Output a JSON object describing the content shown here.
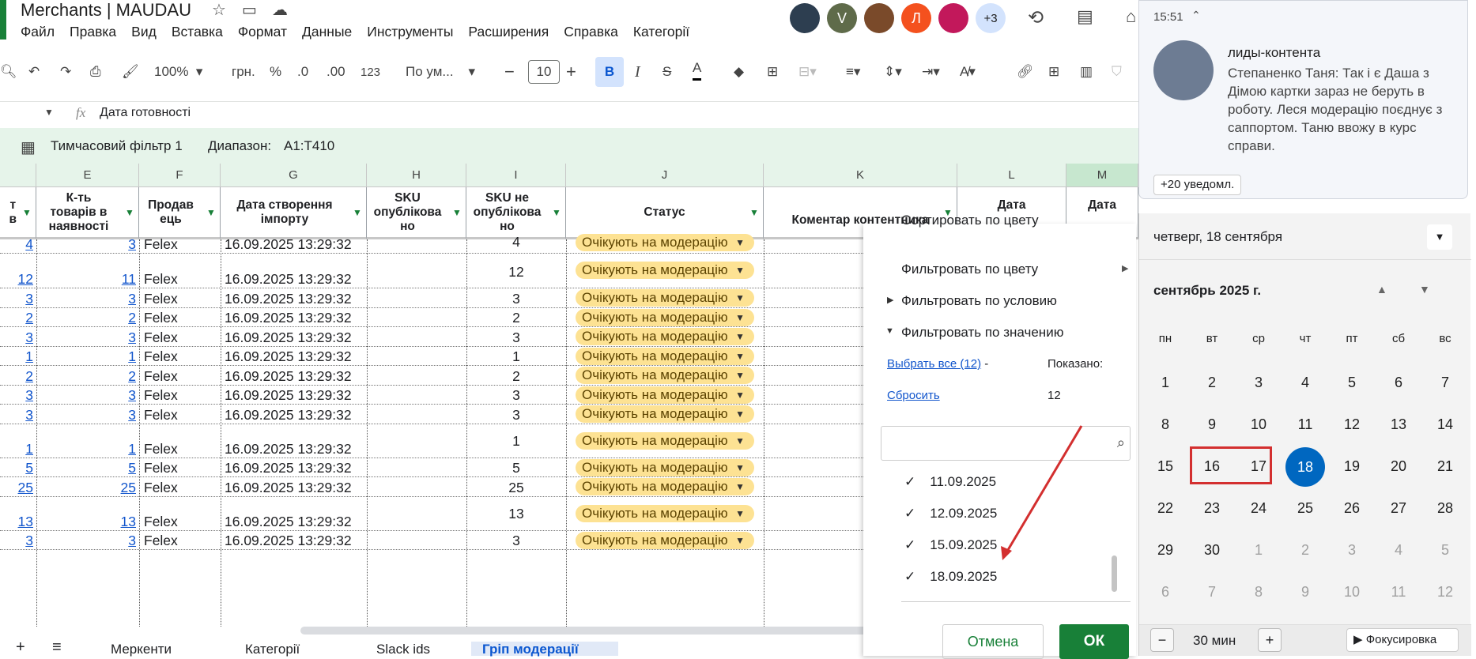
{
  "title": "Merchants | MAUDAU",
  "menu": [
    "Файл",
    "Правка",
    "Вид",
    "Вставка",
    "Формат",
    "Данные",
    "Инструменты",
    "Расширения",
    "Справка",
    "Категорії"
  ],
  "avatars": [
    {
      "letter": "V",
      "color": "#5f6b4a"
    },
    {
      "letter": "Л",
      "color": "#f4511e"
    },
    {
      "letter": "+3",
      "color": "#d3e3fd"
    }
  ],
  "toolbar": {
    "zoom": "100%",
    "currency": "грн.",
    "percent": "%",
    "dec_dec": ".0",
    "inc_dec": ".00",
    "fmt123": "123",
    "font": "По ум...",
    "font_size": "10",
    "bold": "B",
    "italic": "I"
  },
  "formula": {
    "content": "Дата готовності",
    "fx": "fx"
  },
  "filterbar": {
    "name": "Тимчасовий фільтр 1",
    "range_label": "Диапазон:",
    "range": "A1:T410"
  },
  "columns": [
    "E",
    "F",
    "G",
    "H",
    "I",
    "J",
    "K",
    "L",
    "M"
  ],
  "headers": {
    "d": "т\nв",
    "e": "К-ть\nтоварів в\nнаявності",
    "f": "Продав\nець",
    "g": "Дата створення\nімпорту",
    "h": "SKU\nопублікова\nно",
    "i": "SKU не\nопублікова\nно",
    "j": "Статус",
    "k": "Коментар контентника",
    "l": "Дата",
    "m": "Дата"
  },
  "rows": [
    {
      "d": "4",
      "e": "3",
      "f": "Felex",
      "g": "16.09.2025 13:29:32",
      "i": "4",
      "status": "Очікують на модерацію"
    },
    {
      "d": "12",
      "e": "11",
      "f": "Felex",
      "g": "16.09.2025 13:29:32",
      "i": "12",
      "status": "Очікують на модерацію"
    },
    {
      "d": "3",
      "e": "3",
      "f": "Felex",
      "g": "16.09.2025 13:29:32",
      "i": "3",
      "status": "Очікують на модерацію"
    },
    {
      "d": "2",
      "e": "2",
      "f": "Felex",
      "g": "16.09.2025 13:29:32",
      "i": "2",
      "status": "Очікують на модерацію"
    },
    {
      "d": "3",
      "e": "3",
      "f": "Felex",
      "g": "16.09.2025 13:29:32",
      "i": "3",
      "status": "Очікують на модерацію"
    },
    {
      "d": "1",
      "e": "1",
      "f": "Felex",
      "g": "16.09.2025 13:29:32",
      "i": "1",
      "status": "Очікують на модерацію"
    },
    {
      "d": "2",
      "e": "2",
      "f": "Felex",
      "g": "16.09.2025 13:29:32",
      "i": "2",
      "status": "Очікують на модерацію"
    },
    {
      "d": "3",
      "e": "3",
      "f": "Felex",
      "g": "16.09.2025 13:29:32",
      "i": "3",
      "status": "Очікують на модерацію"
    },
    {
      "d": "3",
      "e": "3",
      "f": "Felex",
      "g": "16.09.2025 13:29:32",
      "i": "3",
      "status": "Очікують на модерацію"
    },
    {
      "d": "1",
      "e": "1",
      "f": "Felex",
      "g": "16.09.2025 13:29:32",
      "i": "1",
      "status": "Очікують на модерацію"
    },
    {
      "d": "5",
      "e": "5",
      "f": "Felex",
      "g": "16.09.2025 13:29:32",
      "i": "5",
      "status": "Очікують на модерацію"
    },
    {
      "d": "25",
      "e": "25",
      "f": "Felex",
      "g": "16.09.2025 13:29:32",
      "i": "25",
      "status": "Очікують на модерацію"
    },
    {
      "d": "13",
      "e": "13",
      "f": "Felex",
      "g": "16.09.2025 13:29:32",
      "i": "13",
      "status": "Очікують на модерацію"
    },
    {
      "d": "3",
      "e": "3",
      "f": "Felex",
      "g": "16.09.2025 13:29:32",
      "i": "3",
      "status": "Очікують на модерацію"
    }
  ],
  "filter_menu": {
    "sort_color": "Сортировать по цвету",
    "filter_color": "Фильтровать по цвету",
    "filter_condition": "Фильтровать по условию",
    "filter_value": "Фильтровать по значению",
    "select_all": "Выбрать все (12)",
    "dash": "-",
    "shown_label": "Показано:",
    "reset": "Сбросить",
    "shown_count": "12",
    "values": [
      "11.09.2025",
      "12.09.2025",
      "15.09.2025",
      "18.09.2025"
    ],
    "cancel": "Отмена",
    "ok": "ОК"
  },
  "notification": {
    "time": "15:51",
    "sender": "лиды-контента",
    "text": "Степаненко Таня: Так і є Даша з Дімою картки зараз не беруть в роботу. Леся модерацію поєднує з саппортом. Таню ввожу в курс справи.",
    "more": "+20 уведомл."
  },
  "calendar": {
    "date_header": "четверг, 18 сентября",
    "month": "сентябрь 2025 г.",
    "weekdays": [
      "пн",
      "вт",
      "ср",
      "чт",
      "пт",
      "сб",
      "вс"
    ],
    "weeks": [
      [
        "1",
        "2",
        "3",
        "4",
        "5",
        "6",
        "7"
      ],
      [
        "8",
        "9",
        "10",
        "11",
        "12",
        "13",
        "14"
      ],
      [
        "15",
        "16",
        "17",
        "18",
        "19",
        "20",
        "21"
      ],
      [
        "22",
        "23",
        "24",
        "25",
        "26",
        "27",
        "28"
      ],
      [
        "29",
        "30",
        "1",
        "2",
        "3",
        "4",
        "5"
      ],
      [
        "6",
        "7",
        "8",
        "9",
        "10",
        "11",
        "12"
      ]
    ],
    "today": "18",
    "focus_minutes": "30 мин",
    "focus_label": "Фокусировка"
  },
  "tabs": [
    "Меркенти",
    "Категорії",
    "Slack ids",
    "Гріп модерації"
  ]
}
